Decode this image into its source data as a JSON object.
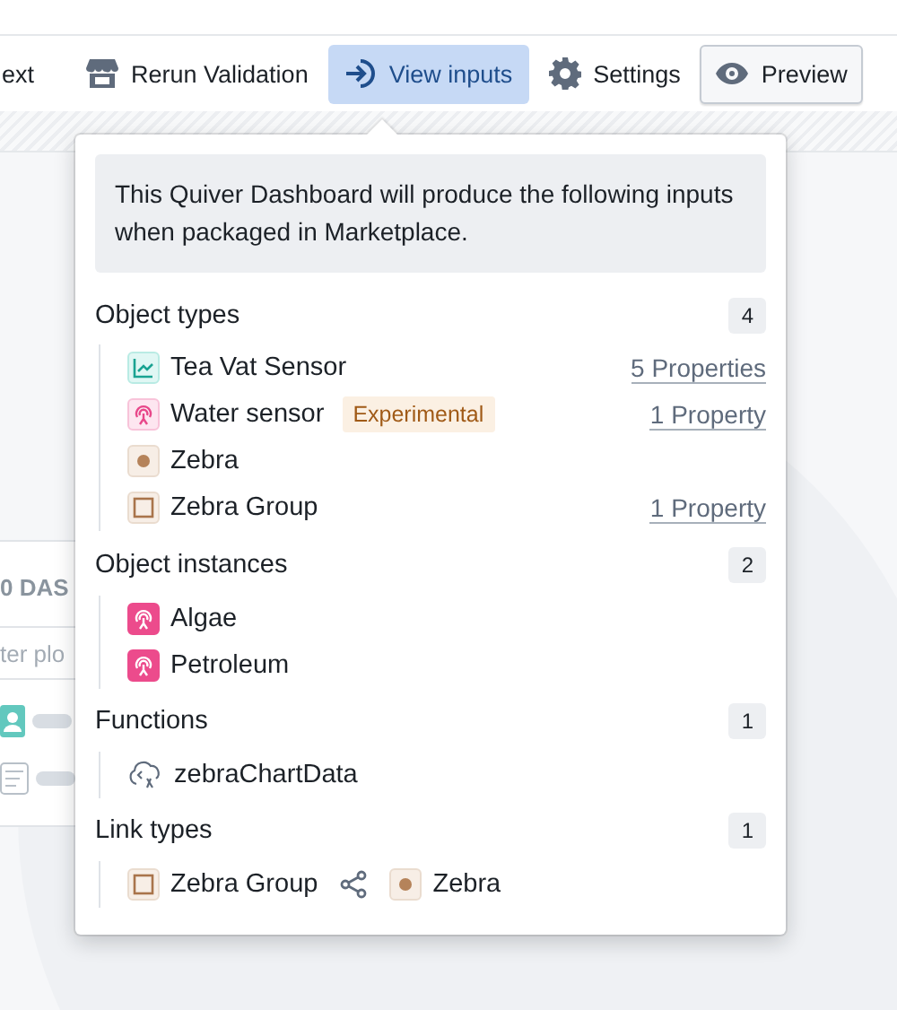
{
  "toolbar": {
    "items": [
      {
        "label": "ext",
        "kind": "text",
        "selected": false
      },
      {
        "label": "Rerun Validation",
        "kind": "store",
        "selected": false
      },
      {
        "label": "View inputs",
        "kind": "inputs",
        "selected": true
      },
      {
        "label": "Settings",
        "kind": "gear",
        "selected": false
      },
      {
        "label": "Preview",
        "kind": "preview",
        "selected": false
      }
    ]
  },
  "background_card": {
    "title": "0 DAS",
    "search_placeholder": "ter plo"
  },
  "popover": {
    "intro": "This Quiver Dashboard will produce the following inputs when packaged in Marketplace.",
    "sections": [
      {
        "title": "Object types",
        "count": "4",
        "items": [
          {
            "kind": "timeseries",
            "name": "Tea Vat Sensor",
            "link": "5 Properties"
          },
          {
            "kind": "sensor",
            "name": "Water sensor",
            "tag": "Experimental",
            "link": "1 Property"
          },
          {
            "kind": "point",
            "name": "Zebra"
          },
          {
            "kind": "group",
            "name": "Zebra Group",
            "link": "1 Property"
          }
        ]
      },
      {
        "title": "Object instances",
        "count": "2",
        "items": [
          {
            "kind": "instance",
            "name": "Algae"
          },
          {
            "kind": "instance",
            "name": "Petroleum"
          }
        ]
      },
      {
        "title": "Functions",
        "count": "1",
        "items": [
          {
            "kind": "function",
            "name": "zebraChartData"
          }
        ]
      },
      {
        "title": "Link types",
        "count": "1",
        "links": [
          {
            "from": {
              "kind": "group",
              "name": "Zebra Group"
            },
            "to": {
              "kind": "point",
              "name": "Zebra"
            }
          }
        ]
      }
    ]
  }
}
